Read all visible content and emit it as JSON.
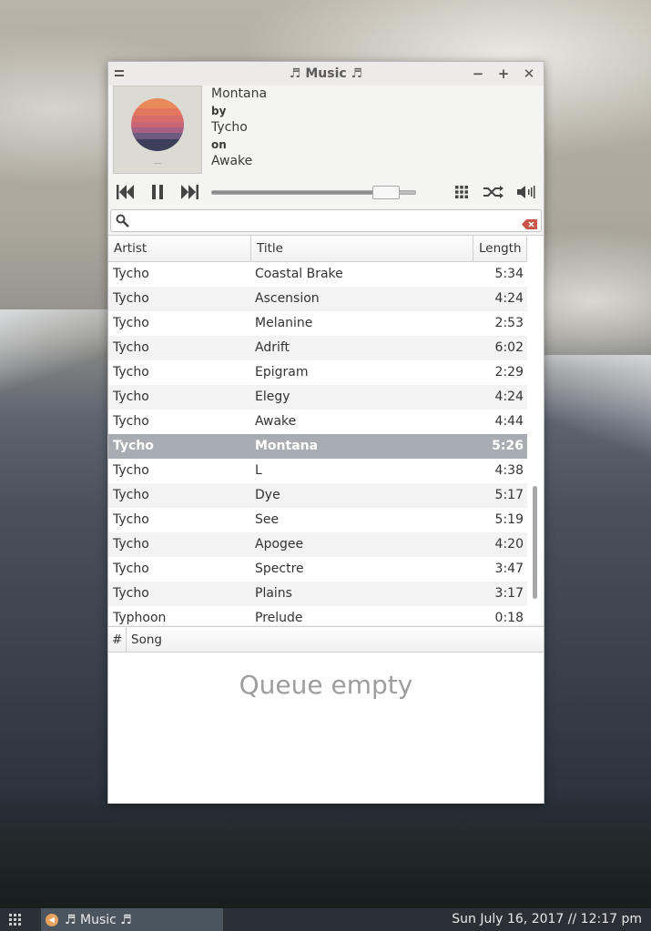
{
  "window": {
    "title": "♬ Music ♬",
    "menu_icon": "hamburger-icon",
    "minimize_label": "−",
    "maximize_label": "+",
    "close_label": "✕"
  },
  "now_playing": {
    "title": "Montana",
    "by_label": "by",
    "artist": "Tycho",
    "on_label": "on",
    "album": "Awake",
    "progress_fraction": 0.9
  },
  "controls": {
    "icons": [
      "skip-previous-icon",
      "pause-icon",
      "skip-next-icon",
      "grid-icon",
      "shuffle-icon",
      "volume-icon"
    ]
  },
  "search": {
    "value": "",
    "placeholder": ""
  },
  "library": {
    "columns": [
      "Artist",
      "Title",
      "Length"
    ],
    "rows": [
      {
        "artist": "Tycho",
        "title": "Coastal Brake",
        "length": "5:34"
      },
      {
        "artist": "Tycho",
        "title": "Ascension",
        "length": "4:24"
      },
      {
        "artist": "Tycho",
        "title": "Melanine",
        "length": "2:53"
      },
      {
        "artist": "Tycho",
        "title": "Adrift",
        "length": "6:02"
      },
      {
        "artist": "Tycho",
        "title": "Epigram",
        "length": "2:29"
      },
      {
        "artist": "Tycho",
        "title": "Elegy",
        "length": "4:24"
      },
      {
        "artist": "Tycho",
        "title": "Awake",
        "length": "4:44"
      },
      {
        "artist": "Tycho",
        "title": "Montana",
        "length": "5:26",
        "selected": true
      },
      {
        "artist": "Tycho",
        "title": "L",
        "length": "4:38"
      },
      {
        "artist": "Tycho",
        "title": "Dye",
        "length": "5:17"
      },
      {
        "artist": "Tycho",
        "title": "See",
        "length": "5:19"
      },
      {
        "artist": "Tycho",
        "title": "Apogee",
        "length": "4:20"
      },
      {
        "artist": "Tycho",
        "title": "Spectre",
        "length": "3:47"
      },
      {
        "artist": "Tycho",
        "title": "Plains",
        "length": "3:17"
      },
      {
        "artist": "Typhoon",
        "title": "Prelude",
        "length": "0:18"
      }
    ]
  },
  "queue": {
    "columns": [
      "#",
      "Song"
    ],
    "empty_text": "Queue empty"
  },
  "taskbar": {
    "task_label": "♬ Music ♬",
    "clock": "Sun July 16, 2017  //  12:17 pm"
  },
  "colors": {
    "selected_row": "#a8adb3",
    "taskbar": "#2b3036",
    "active_task": "#4b5560"
  }
}
